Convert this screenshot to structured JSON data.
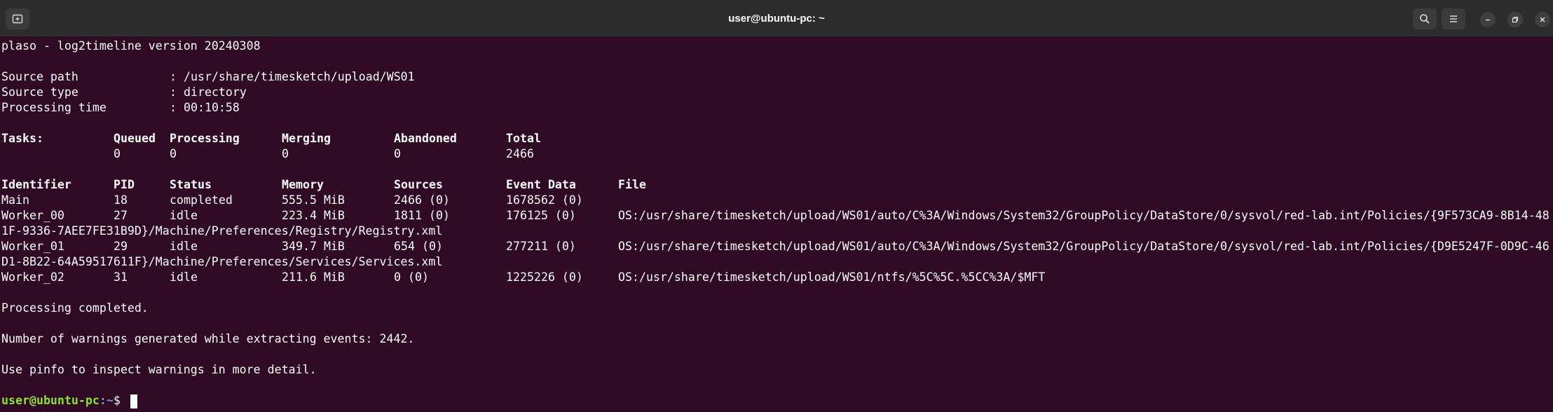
{
  "window": {
    "title": "user@ubuntu-pc: ~"
  },
  "terminal": {
    "header": "plaso - log2timeline version 20240308",
    "info": [
      {
        "label": "Source path",
        "value": ": /usr/share/timesketch/upload/WS01"
      },
      {
        "label": "Source type",
        "value": ": directory"
      },
      {
        "label": "Processing time",
        "value": ": 00:10:58"
      }
    ],
    "tasks": {
      "headers": [
        "Tasks:",
        "Queued",
        "Processing",
        "Merging",
        "Abandoned",
        "Total"
      ],
      "values": [
        "0",
        "0",
        "0",
        "0",
        "2466"
      ]
    },
    "workers": {
      "headers": [
        "Identifier",
        "PID",
        "Status",
        "Memory",
        "Sources",
        "Event Data",
        "File"
      ],
      "rows": [
        {
          "id": "Main",
          "pid": "18",
          "status": "completed",
          "memory": "555.5 MiB",
          "sources": "2466 (0)",
          "events": "1678562 (0)",
          "file": "",
          "file_cont": ""
        },
        {
          "id": "Worker_00",
          "pid": "27",
          "status": "idle",
          "memory": "223.4 MiB",
          "sources": "1811 (0)",
          "events": "176125 (0)",
          "file": "OS:/usr/share/timesketch/upload/WS01/auto/C%3A/Windows/System32/GroupPolicy/DataStore/0/sysvol/red-lab.int/Policies/{9F573CA9-8B14-48",
          "file_cont": "1F-9336-7AEE7FE31B9D}/Machine/Preferences/Registry/Registry.xml"
        },
        {
          "id": "Worker_01",
          "pid": "29",
          "status": "idle",
          "memory": "349.7 MiB",
          "sources": "654 (0)",
          "events": "277211 (0)",
          "file": "OS:/usr/share/timesketch/upload/WS01/auto/C%3A/Windows/System32/GroupPolicy/DataStore/0/sysvol/red-lab.int/Policies/{D9E5247F-0D9C-46",
          "file_cont": "D1-8B22-64A59517611F}/Machine/Preferences/Services/Services.xml"
        },
        {
          "id": "Worker_02",
          "pid": "31",
          "status": "idle",
          "memory": "211.6 MiB",
          "sources": "0 (0)",
          "events": "1225226 (0)",
          "file": "OS:/usr/share/timesketch/upload/WS01/ntfs/%5C%5C.%5CC%3A/$MFT",
          "file_cont": ""
        }
      ]
    },
    "messages": [
      "Processing completed.",
      "Number of warnings generated while extracting events: 2442.",
      "Use pinfo to inspect warnings in more detail."
    ],
    "prompt": {
      "user": "user@ubuntu-pc",
      "path": ":~",
      "symbol": "$ "
    }
  }
}
